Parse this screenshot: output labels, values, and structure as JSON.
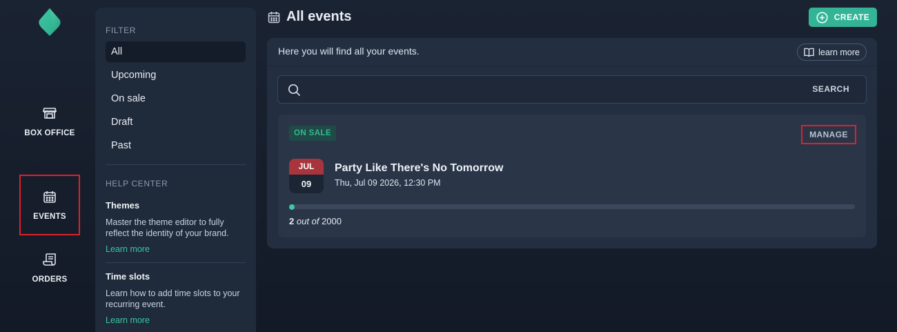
{
  "rail": {
    "items": [
      {
        "label": "BOX OFFICE",
        "icon": "storefront-icon"
      },
      {
        "label": "EVENTS",
        "icon": "calendar-icon",
        "active": true
      },
      {
        "label": "ORDERS",
        "icon": "receipt-icon"
      }
    ]
  },
  "filter": {
    "title": "FILTER",
    "items": [
      "All",
      "Upcoming",
      "On sale",
      "Draft",
      "Past"
    ],
    "selected": "All"
  },
  "help": {
    "title": "HELP CENTER",
    "articles": [
      {
        "title": "Themes",
        "text": "Master the theme editor to fully reflect the identity of your brand.",
        "link": "Learn more"
      },
      {
        "title": "Time slots",
        "text": "Learn how to add time slots to your recurring event.",
        "link": "Learn more"
      }
    ]
  },
  "header": {
    "title": "All events",
    "create_label": "CREATE"
  },
  "intro": {
    "text": "Here you will find all your events.",
    "learn_more": "learn more"
  },
  "search": {
    "placeholder": "",
    "value": "",
    "button": "SEARCH"
  },
  "event": {
    "status": "ON SALE",
    "manage_label": "MANAGE",
    "month": "JUL",
    "day": "09",
    "title": "Party Like There's No Tomorrow",
    "datetime": "Thu, Jul 09 2026, 12:30 PM",
    "sold": "2",
    "out_of": "out of",
    "capacity": "2000",
    "progress_fraction": 0.001
  },
  "colors": {
    "accent": "#34b496",
    "badge_bg": "#1f4a48",
    "date_red": "#a8353c",
    "highlight_red": "#e0202a"
  }
}
